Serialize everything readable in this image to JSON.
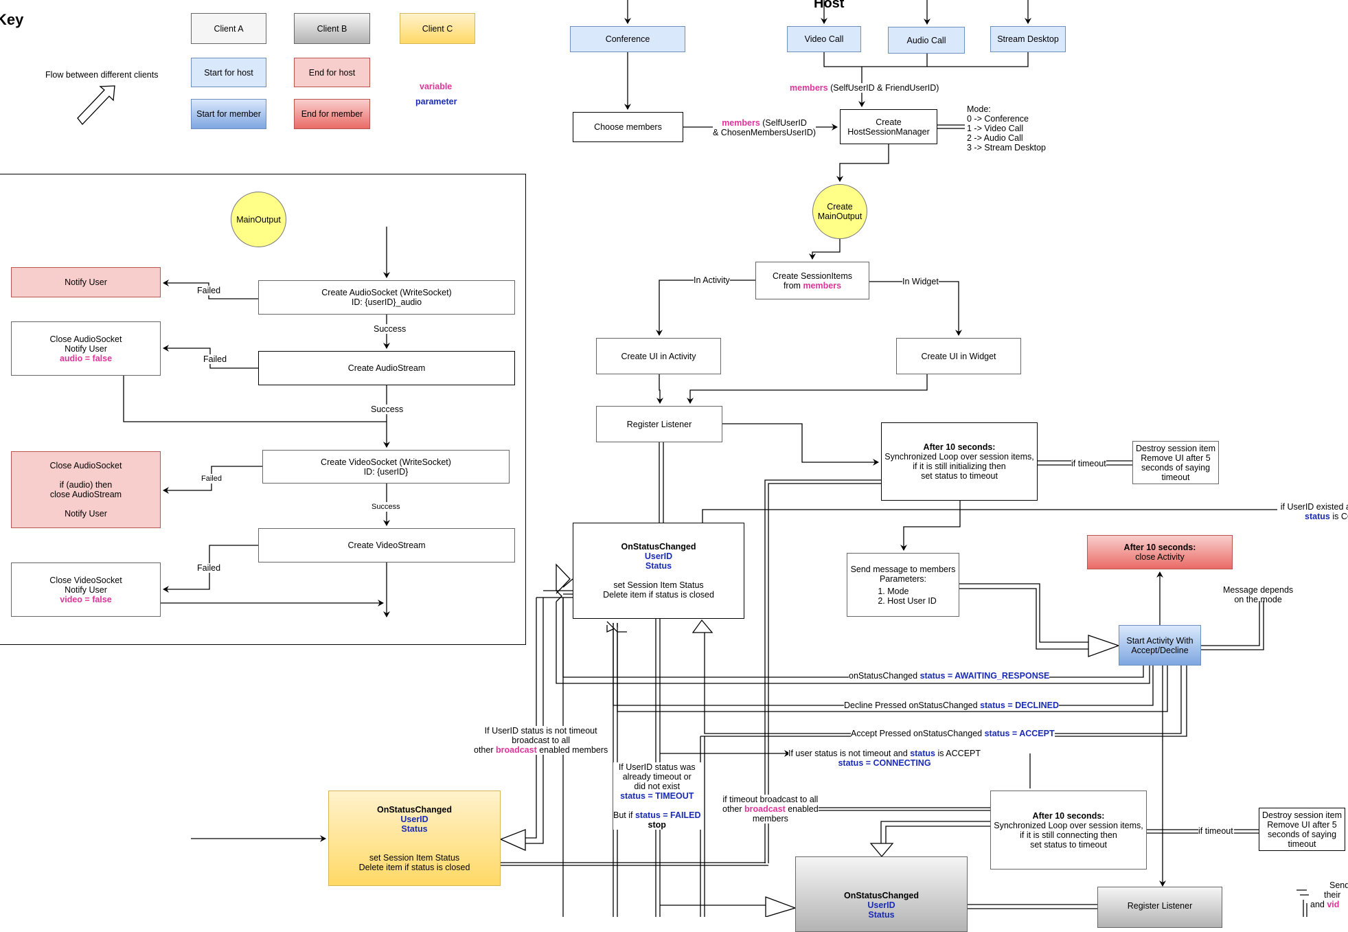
{
  "key": {
    "title": "Key",
    "flow_label": "Flow between different clients",
    "client_a": "Client A",
    "client_b": "Client B",
    "client_c": "Client C",
    "start_host": "Start for host",
    "end_host": "End for host",
    "start_member": "Start for member",
    "end_member": "End for member",
    "variable": "variable",
    "parameter": "parameter"
  },
  "colors": {
    "variable": "#e0339a",
    "parameter": "#1a2bb5",
    "start_host": "#dae8fc",
    "end_host": "#f8cecc",
    "client_c": "#ffd966",
    "main_output": "#ffff88"
  },
  "socket_flow": {
    "main_output": "MainOutput",
    "notify_user": "Notify User",
    "create_audio_socket": [
      "Create AudioSocket (WriteSocket)",
      "ID: {userID}_audio"
    ],
    "close_audio_socket_1": [
      "Close AudioSocket",
      "Notify User"
    ],
    "audio_false": "audio = false",
    "create_audio_stream": "Create AudioStream",
    "close_audio_socket_2": [
      "Close AudioSocket",
      "if (audio) then",
      "close AudioStream",
      "Notify User"
    ],
    "create_video_socket": [
      "Create VideoSocket (WriteSocket)",
      "ID: {userID}"
    ],
    "create_video_stream": "Create VideoStream",
    "close_video_socket": [
      "Close VideoSocket",
      "Notify User"
    ],
    "video_false": "video = false",
    "failed": "Failed",
    "success": "Success"
  },
  "host": {
    "title": "Host",
    "conference": "Conference",
    "video_call": "Video Call",
    "audio_call": "Audio Call",
    "stream_desktop": "Stream Desktop",
    "choose_members": "Choose members",
    "members_var": "members",
    "members_friend": "(SelfUserID & FriendUserID)",
    "members_chosen_1": "(SelfUserID",
    "members_chosen_2": "& ChosenMembersUserID)",
    "create_hsm": [
      "Create",
      "HostSessionManager"
    ],
    "mode": [
      "Mode:",
      "0 -> Conference",
      "1 -> Video Call",
      "2 -> Audio Call",
      "3 -> Stream Desktop"
    ],
    "create_main_output": [
      "Create",
      "MainOutput"
    ],
    "create_session_items": "Create SessionItems",
    "from": "from",
    "in_activity": "In Activity",
    "in_widget": "In Widget",
    "ui_activity": "Create UI in Activity",
    "ui_widget": "Create UI in Widget",
    "register_listener": "Register Listener",
    "after10_title": "After 10 seconds:",
    "after10_init": [
      "Synchronized Loop over session items,",
      "if it is still initializing then",
      "set status to timeout"
    ],
    "if_timeout": "if timeout",
    "destroy": [
      "Destroy session item",
      "Remove UI after 5",
      "seconds of saying",
      "timeout"
    ],
    "on_status_changed": "OnStatusChanged",
    "userid": "UserID",
    "status": "Status",
    "set_status": "set Session Item Status",
    "delete_item": "Delete item if status is closed",
    "send_message": [
      "Send message to members",
      "Parameters:"
    ],
    "send_params": [
      "Mode",
      "Host User ID"
    ],
    "if_userid_existed": "if UserID existed a",
    "status_word": "status",
    "is_co": "is CO"
  },
  "member": {
    "after10_close_title": "After 10 seconds:",
    "after10_close": "close Activity",
    "start_activity": [
      "Start Activity With",
      "Accept/Decline"
    ],
    "message_depends": [
      "Message depends",
      "on the mode"
    ],
    "awaiting_prefix": "onStatusChanged",
    "awaiting_status": "status = AWAITING_RESPONSE",
    "declined_prefix": "Decline Pressed onStatusChanged",
    "declined_status": "status = DECLINED",
    "accept_prefix": "Accept Pressed onStatusChanged",
    "accept_status": "status = ACCEPT",
    "connecting_prefix": "If user status is not timeout and",
    "connecting_status_word": "status",
    "connecting_suffix": "is ACCEPT",
    "connecting_status": "status = CONNECTING",
    "not_timeout_1": "If UserID status is not timeout",
    "not_timeout_2": "broadcast to all",
    "not_timeout_3a": "other",
    "broadcast_var": "broadcast",
    "not_timeout_3b": "enabled members",
    "already_timeout": [
      "If UserID status was",
      "already timeout or",
      "did not exist"
    ],
    "status_timeout": "status = TIMEOUT",
    "but_if": "But if",
    "status_failed": "status = FAILED",
    "stop": "stop",
    "timeout_broadcast_1": "if timeout broadcast to all",
    "timeout_broadcast_2a": "other",
    "timeout_broadcast_2b": "enabled",
    "timeout_broadcast_3": "members",
    "after10_connecting": [
      "Synchronized Loop over session items,",
      "if it is still connecting then",
      "set status to timeout"
    ],
    "register_listener": "Register Listener",
    "send_partial": [
      "Send",
      "their",
      "and"
    ],
    "vid_partial": "vid"
  }
}
